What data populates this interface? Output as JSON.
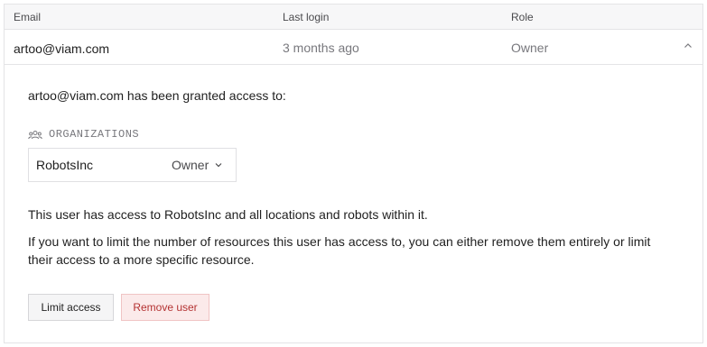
{
  "table": {
    "headers": {
      "email": "Email",
      "last_login": "Last login",
      "role": "Role"
    },
    "row": {
      "email": "artoo@viam.com",
      "last_login": "3 months ago",
      "role": "Owner"
    }
  },
  "details": {
    "granted_text": "artoo@viam.com has been granted access to:",
    "organizations_label": "ORGANIZATIONS",
    "organization": {
      "name": "RobotsInc",
      "role": "Owner"
    },
    "access_info": "This user has access to RobotsInc and all locations and robots within it.",
    "limit_info": "If you want to limit the number of resources this user has access to, you can either remove them entirely or limit their access to a more specific resource."
  },
  "actions": {
    "limit_access": "Limit access",
    "remove_user": "Remove user"
  },
  "colors": {
    "remove_bg": "#fbeaea",
    "remove_text": "#b43232",
    "header_bg": "#f7f7f8"
  },
  "icons": {
    "collapse": "chevron-up-icon",
    "role_dropdown": "chevron-down-icon",
    "organizations": "users-group-icon"
  }
}
